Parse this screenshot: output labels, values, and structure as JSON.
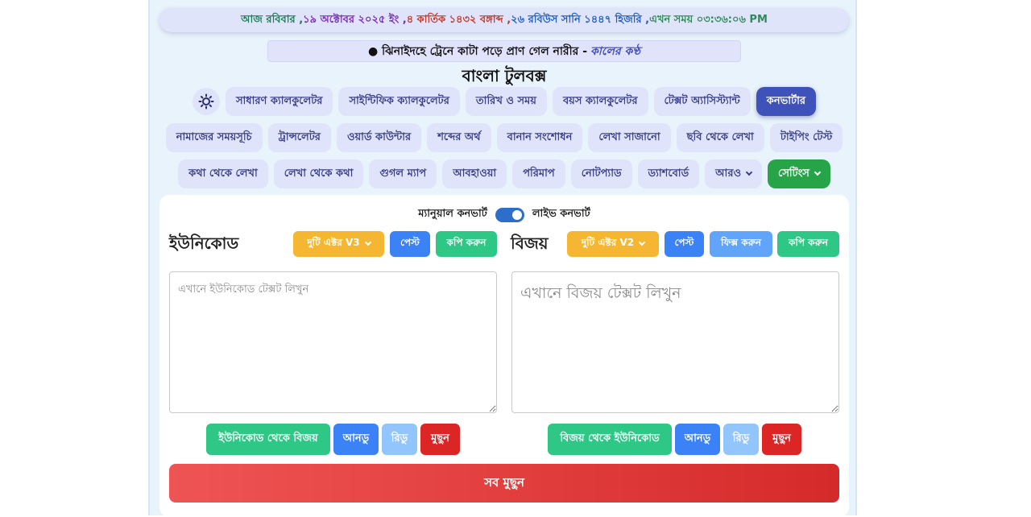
{
  "datebar": {
    "day_text": "আজ  রবিবার ,",
    "english_date": " ১৯ অক্টোবর ২০২৫ ইং ,",
    "bangla_date": " ৪ কার্তিক ১৪৩২ বঙ্গাব্দ ,",
    "hijri_date": " ২৬ রবিউস সানি ১৪৪৭ হিজরি ,",
    "time_text": " এখন সময়  ০৩:৩৬:০৬ PM",
    "colors": {
      "day": "#1c7c54",
      "english": "#7a2bb3",
      "bangla": "#c0392b",
      "hijri": "#1f5fbf",
      "time": "#2e8b57"
    }
  },
  "ticker": {
    "headline": "● ঝিনাইদহে ট্রেনে কাটা পড়ে প্রাণ গেল নারীর -",
    "source": "কালের কণ্ঠ"
  },
  "title": "বাংলা টুলবক্স",
  "nav": {
    "row1": [
      "সাধারণ ক্যালকুলেটর",
      "সাইন্টিফিক ক্যালকুলেটর",
      "তারিখ ও সময়",
      "বয়স ক্যালকুলেটর",
      "টেক্সট অ্যাসিস্ট্যান্ট",
      "কনভার্টার"
    ],
    "row2": [
      "নামাজের সময়সূচি",
      "ট্রান্সলেটর",
      "ওয়ার্ড কাউন্টার",
      "শব্দের অর্থ",
      "বানান সংশোধন",
      "লেখা সাজানো",
      "ছবি থেকে লেখা",
      "টাইপিং টেস্ট"
    ],
    "row3": [
      "কথা থেকে লেখা",
      "লেখা থেকে কথা",
      "গুগল ম্যাপ",
      "আবহাওয়া",
      "পরিমাপ",
      "নোটপ্যাড",
      "ড্যাশবোর্ড"
    ],
    "more": "আরও",
    "settings": "সেটিংস"
  },
  "converter": {
    "manual_label": "ম্যানুয়াল কনভার্ট",
    "live_label": "লাইভ কনভার্ট",
    "unicode": {
      "title": "ইউনিকোড",
      "font_select": "দুটি এক্টর V3",
      "paste": "পেস্ট",
      "copy": "কপি করুন",
      "placeholder": "এখানে ইউনিকোড টেক্সট লিখুন",
      "convert": "ইউনিকোড থেকে বিজয়",
      "undo": "আনডু",
      "redo": "রিডু",
      "clear": "মুছুন"
    },
    "bijoy": {
      "title": "বিজয়",
      "font_select": "দুটি এক্টর V2",
      "paste": "পেস্ট",
      "fix": "ফিক্স করুন",
      "copy": "কপি করুন",
      "placeholder": "এখানে বিজয় টেক্সট লিখুন",
      "convert": "বিজয় থেকে ইউনিকোড",
      "undo": "আনডু",
      "redo": "রিডু",
      "clear": "মুছুন"
    },
    "clear_all": "সব মুছুন"
  },
  "icons": {
    "theme": "sun-icon",
    "more": "chevron-down-icon",
    "settings": "chevron-down-icon",
    "select": "chevron-down-icon"
  }
}
